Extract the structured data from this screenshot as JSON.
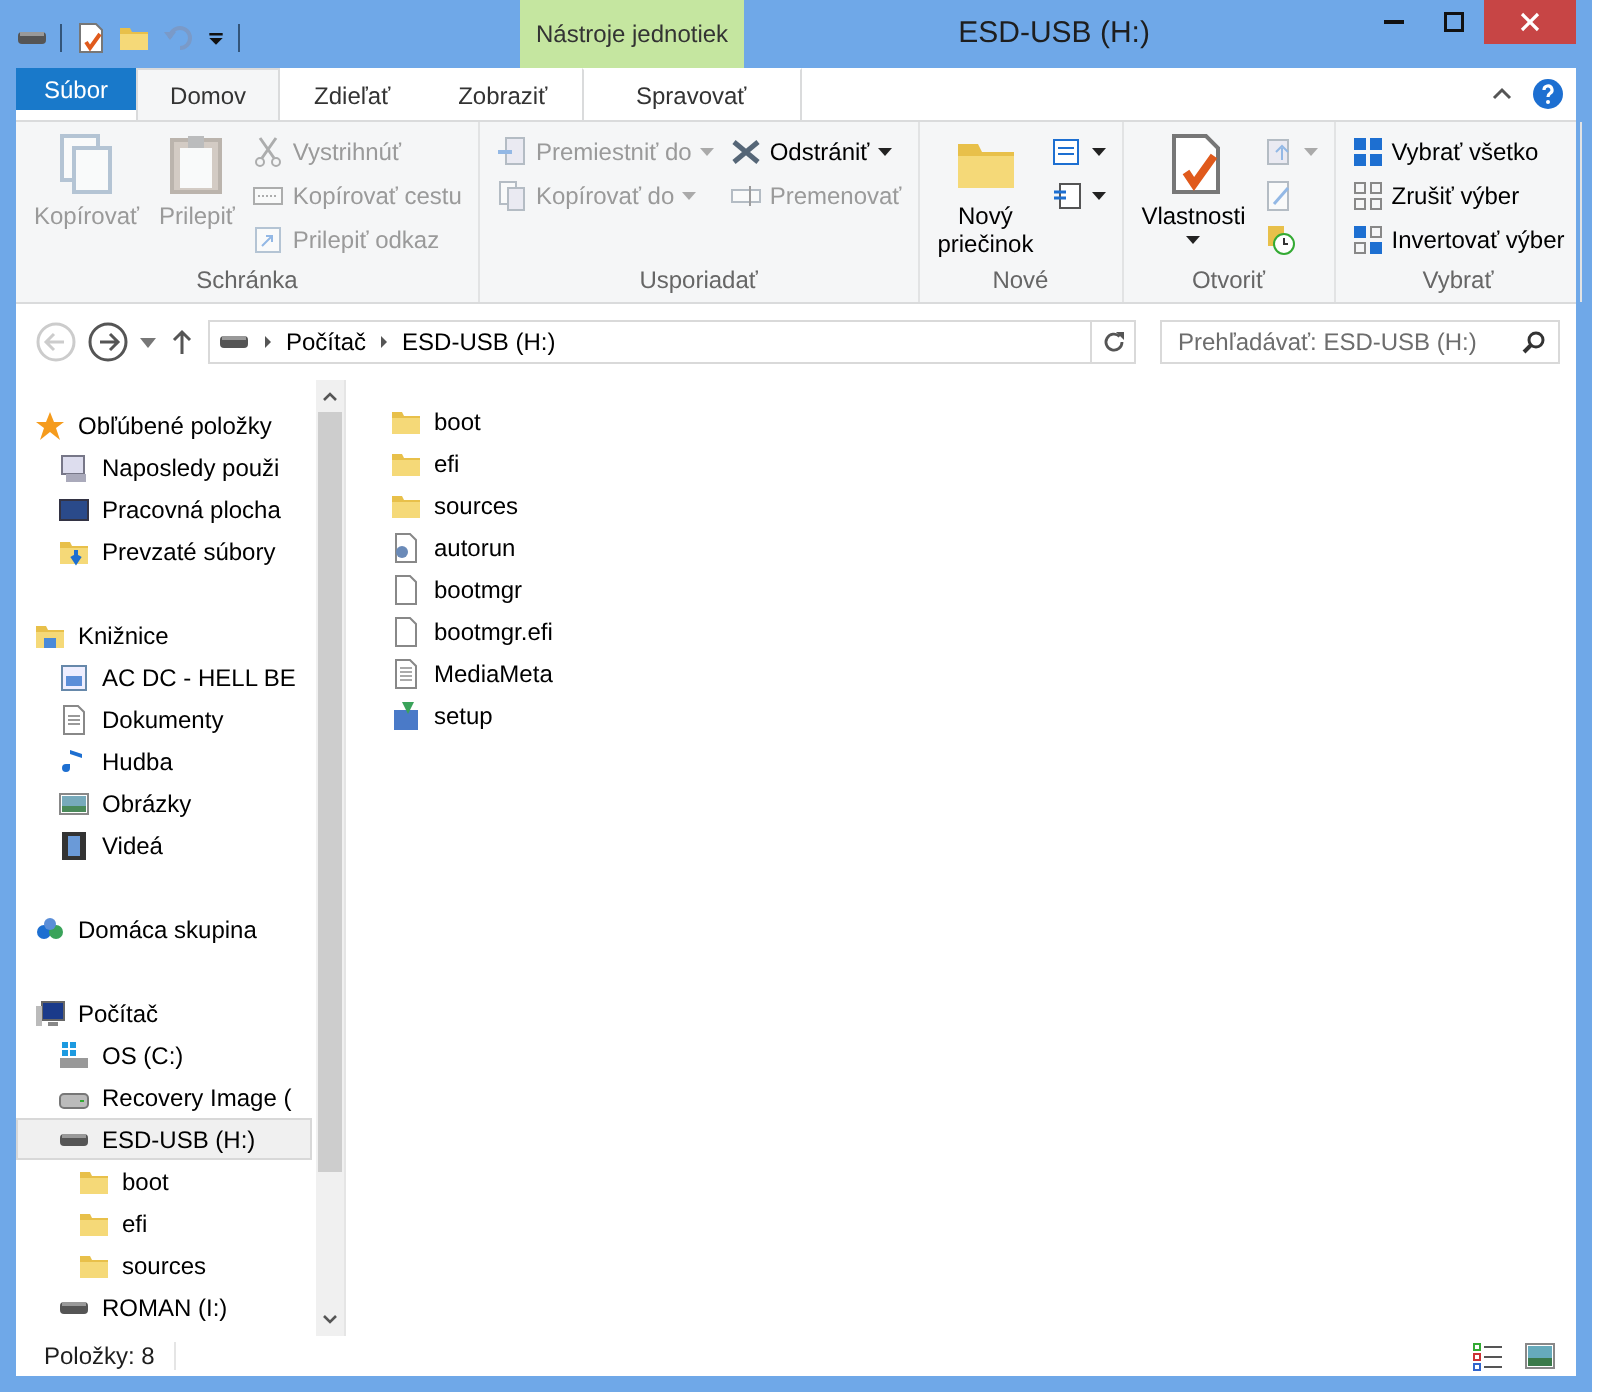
{
  "window": {
    "title": "ESD-USB (H:)",
    "context_tab": "Nástroje jednotiek"
  },
  "ribbon_tabs": [
    {
      "label": "Súbor",
      "kind": "file",
      "selected": false
    },
    {
      "label": "Domov",
      "kind": "tab",
      "selected": true
    },
    {
      "label": "Zdieľať",
      "kind": "tab",
      "selected": false
    },
    {
      "label": "Zobraziť",
      "kind": "tab",
      "selected": false
    },
    {
      "label": "Spravovať",
      "kind": "context",
      "selected": false
    }
  ],
  "ribbon_groups": [
    {
      "label": "Schránka",
      "large_buttons": [
        {
          "kind": "copy",
          "label": "Kopírovať",
          "disabled": true,
          "dropdown": false
        },
        {
          "kind": "paste",
          "label": "Prilepiť",
          "disabled": true,
          "dropdown": false
        }
      ],
      "small_columns": [
        [
          {
            "kind": "cut",
            "label": "Vystrihnúť",
            "disabled": true,
            "dropdown": false
          },
          {
            "kind": "copy-path",
            "label": "Kopírovať cestu",
            "disabled": true,
            "dropdown": false
          },
          {
            "kind": "paste-shortcut",
            "label": "Prilepiť odkaz",
            "disabled": true,
            "dropdown": false
          }
        ]
      ]
    },
    {
      "label": "Usporiadať",
      "small_columns": [
        [
          {
            "kind": "move-to",
            "label": "Premiestniť do",
            "disabled": true,
            "dropdown": true
          },
          {
            "kind": "copy-to",
            "label": "Kopírovať do",
            "disabled": true,
            "dropdown": true
          }
        ],
        [
          {
            "kind": "delete",
            "label": "Odstrániť",
            "disabled": false,
            "dropdown": true
          },
          {
            "kind": "rename",
            "label": "Premenovať",
            "disabled": true,
            "dropdown": false
          }
        ]
      ]
    },
    {
      "label": "Nové",
      "large_buttons": [
        {
          "kind": "new-folder",
          "label": "Nový priečinok",
          "disabled": false,
          "dropdown": false
        }
      ],
      "small_columns": [
        [
          {
            "kind": "new-item",
            "disabled": false,
            "dropdown": true
          },
          {
            "kind": "easy-access",
            "disabled": false,
            "dropdown": true
          }
        ]
      ]
    },
    {
      "label": "Otvoriť",
      "large_buttons": [
        {
          "kind": "properties",
          "label": "Vlastnosti",
          "disabled": false,
          "dropdown": true
        }
      ],
      "small_columns": [
        [
          {
            "kind": "open",
            "disabled": true,
            "dropdown": true
          },
          {
            "kind": "edit",
            "disabled": true,
            "dropdown": false
          },
          {
            "kind": "history",
            "disabled": false,
            "dropdown": false
          }
        ]
      ]
    },
    {
      "label": "Vybrať",
      "small_columns": [
        [
          {
            "kind": "select-all",
            "label": "Vybrať všetko",
            "disabled": false,
            "dropdown": false
          },
          {
            "kind": "select-none",
            "label": "Zrušiť výber",
            "disabled": false,
            "dropdown": false
          },
          {
            "kind": "invert-selection",
            "label": "Invertovať výber",
            "disabled": false,
            "dropdown": false
          }
        ]
      ]
    }
  ],
  "navigation": {
    "back_disabled": true,
    "forward_disabled": false,
    "breadcrumb": [
      "Počítač",
      "ESD-USB (H:)"
    ]
  },
  "search": {
    "placeholder": "Prehľadávať: ESD-USB (H:)"
  },
  "sidebar": {
    "items": [
      {
        "label": "Obľúbené položky",
        "kind": "star",
        "selected": false,
        "children": [
          {
            "label": "Naposledy použi",
            "kind": "recent",
            "selected": false
          },
          {
            "label": "Pracovná plocha",
            "kind": "desktop",
            "selected": false
          },
          {
            "label": "Prevzaté súbory",
            "kind": "downloads",
            "selected": false
          }
        ]
      },
      {
        "label": "Knižnice",
        "kind": "library",
        "selected": false,
        "children": [
          {
            "label": "AC DC - HELL BE",
            "kind": "library-item",
            "selected": false
          },
          {
            "label": "Dokumenty",
            "kind": "documents",
            "selected": false
          },
          {
            "label": "Hudba",
            "kind": "music",
            "selected": false
          },
          {
            "label": "Obrázky",
            "kind": "pictures",
            "selected": false
          },
          {
            "label": "Videá",
            "kind": "videos",
            "selected": false
          }
        ]
      },
      {
        "label": "Domáca skupina",
        "kind": "homegroup",
        "selected": false
      },
      {
        "label": "Počítač",
        "kind": "computer",
        "selected": false,
        "children": [
          {
            "label": "OS (C:)",
            "kind": "system-drive",
            "selected": false
          },
          {
            "label": "Recovery Image (",
            "kind": "drive",
            "selected": false
          },
          {
            "label": "ESD-USB (H:)",
            "kind": "usb",
            "selected": true,
            "children": [
              {
                "label": "boot",
                "kind": "folder",
                "selected": false
              },
              {
                "label": "efi",
                "kind": "folder",
                "selected": false
              },
              {
                "label": "sources",
                "kind": "folder",
                "selected": false
              }
            ]
          },
          {
            "label": "ROMAN (I:)",
            "kind": "usb",
            "selected": false
          }
        ]
      }
    ]
  },
  "files": [
    {
      "name": "boot",
      "kind": "folder"
    },
    {
      "name": "efi",
      "kind": "folder"
    },
    {
      "name": "sources",
      "kind": "folder"
    },
    {
      "name": "autorun",
      "kind": "settings"
    },
    {
      "name": "bootmgr",
      "kind": "file"
    },
    {
      "name": "bootmgr.efi",
      "kind": "file"
    },
    {
      "name": "MediaMeta",
      "kind": "text"
    },
    {
      "name": "setup",
      "kind": "setup"
    }
  ],
  "status_bar": {
    "items": "Položky: 8"
  }
}
